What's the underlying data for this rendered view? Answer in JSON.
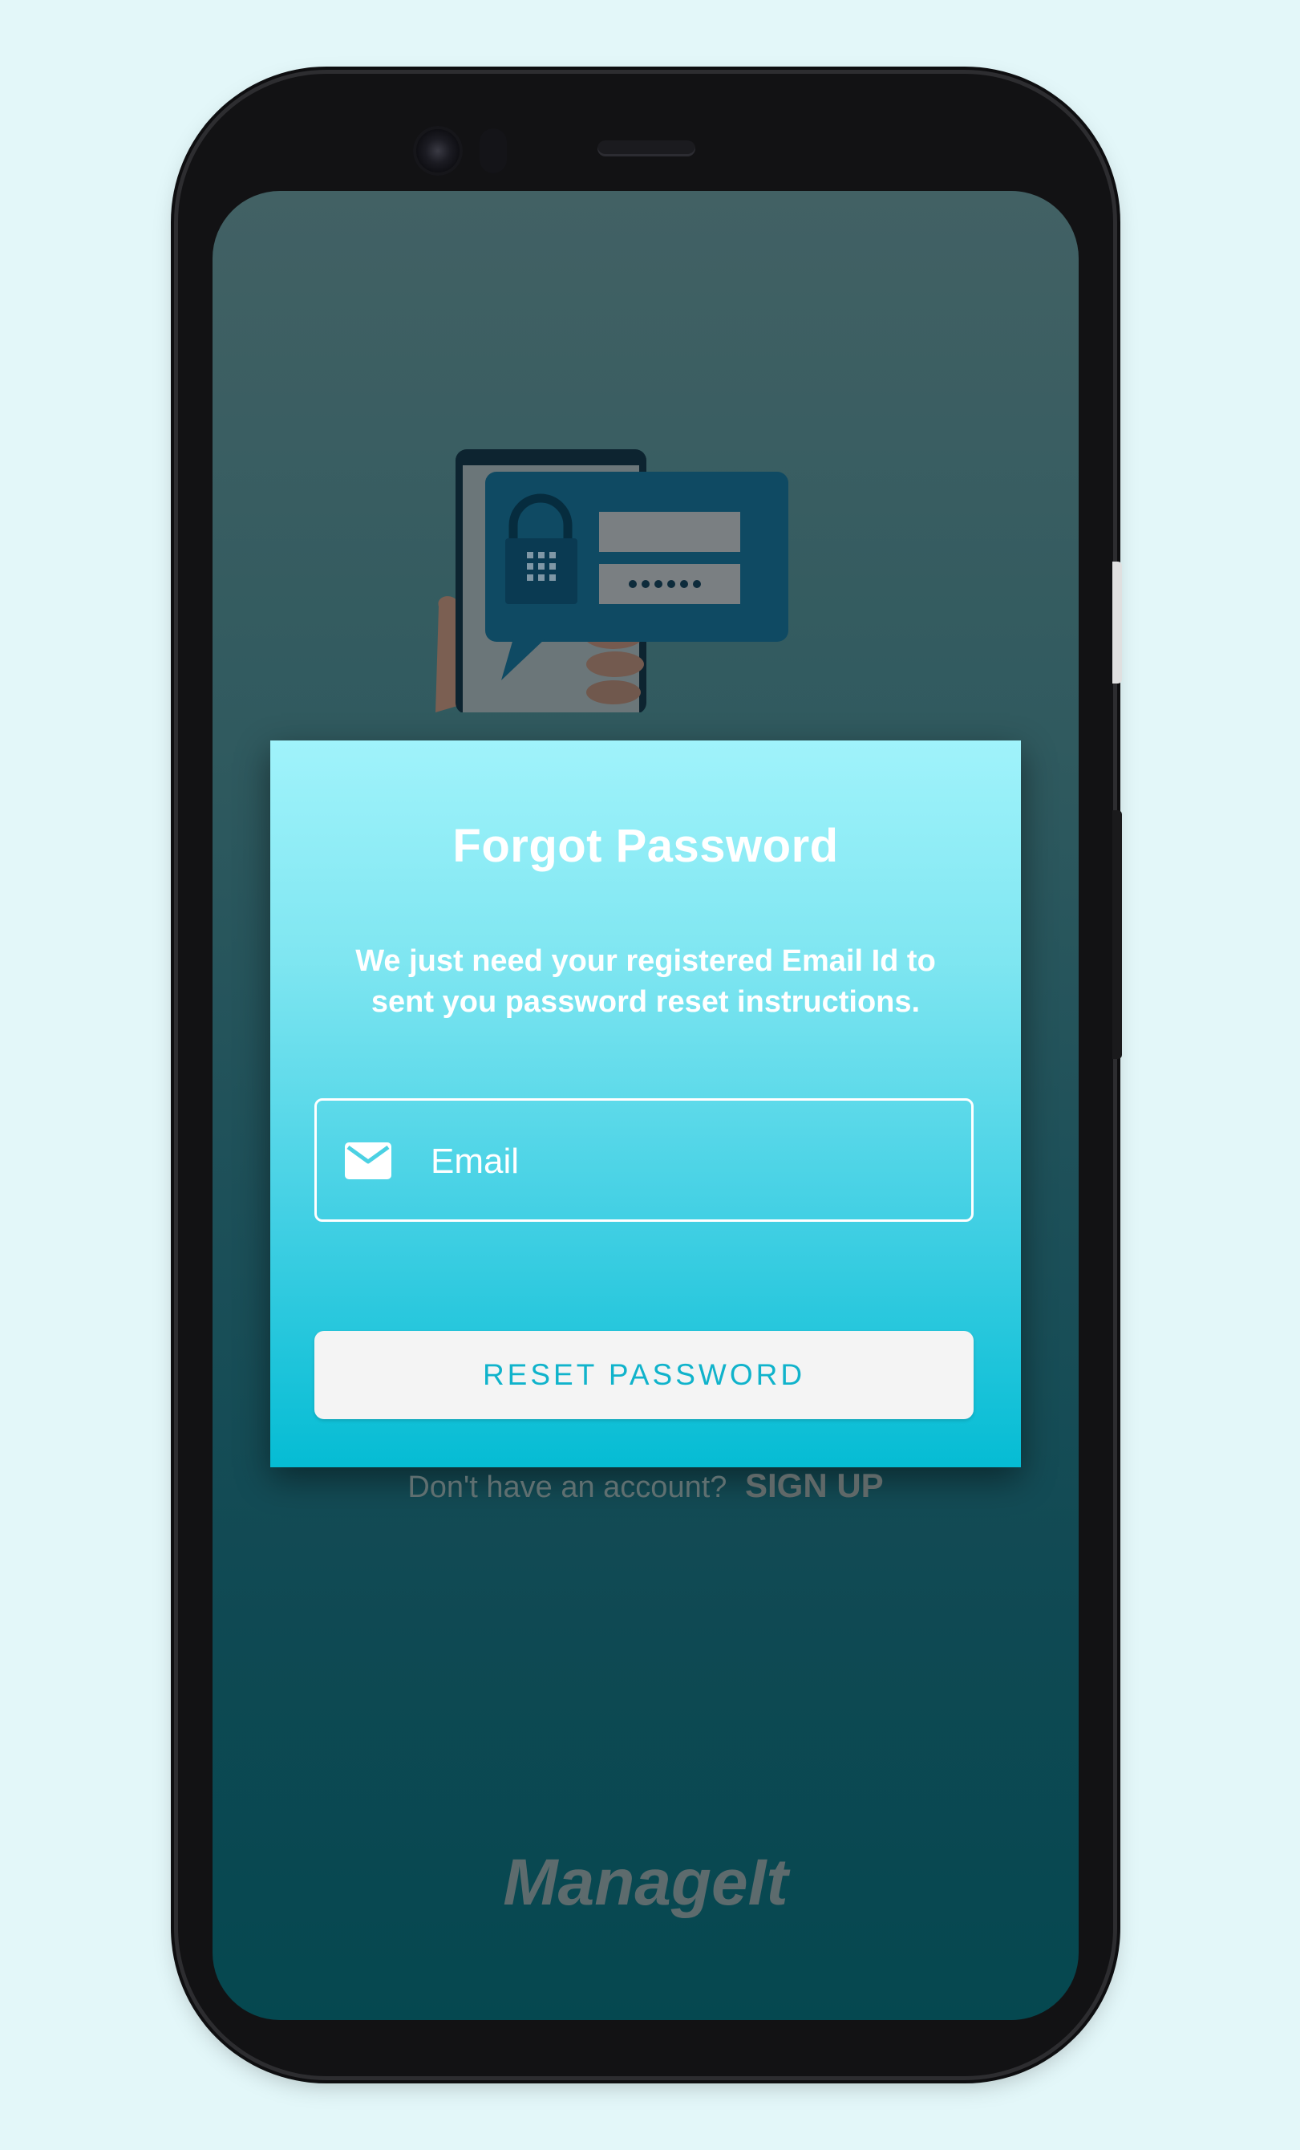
{
  "dialog": {
    "title": "Forgot Password",
    "description": "We just need your registered Email Id to sent you password reset instructions.",
    "email_placeholder": "Email",
    "email_value": "",
    "reset_button_label": "RESET PASSWORD"
  },
  "signup": {
    "prompt": "Don't have an account?",
    "link_label": "SIGN UP"
  },
  "brand": {
    "name": "ManageIt"
  },
  "icons": {
    "email_field_icon": "mail-icon",
    "illustration": "phone-lock-illustration"
  },
  "colors": {
    "page_background": "#e3f7f9",
    "dialog_top": "#a0f3fb",
    "dialog_bottom": "#05bcd4",
    "button_text": "#10b3cb",
    "screen_top": "#426164",
    "screen_bottom": "#054850"
  }
}
